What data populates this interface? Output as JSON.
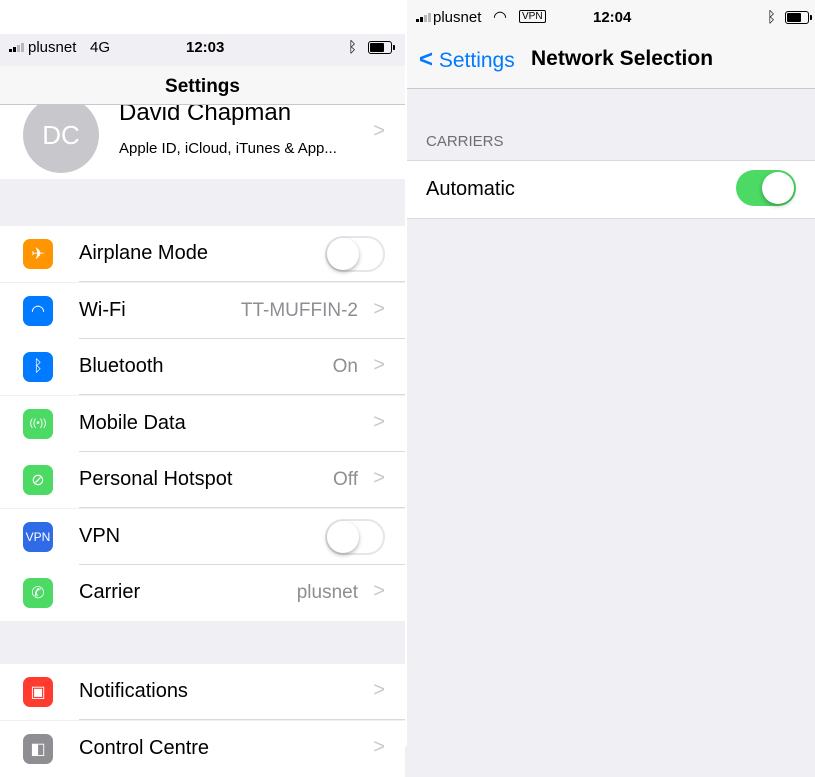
{
  "left": {
    "status": {
      "carrier": "plusnet",
      "network": "4G",
      "time": "12:03"
    },
    "nav_title": "Settings",
    "profile": {
      "initials": "DC",
      "name": "David Chapman",
      "subtitle": "Apple ID, iCloud, iTunes & App..."
    },
    "rows": [
      {
        "label": "Airplane Mode",
        "icon": "airplane-icon",
        "glyph": "✈",
        "color": "#ff9500",
        "toggle": "off"
      },
      {
        "label": "Wi-Fi",
        "icon": "wifi-icon",
        "glyph": "◠",
        "color": "#007aff",
        "value": "TT-MUFFIN-2"
      },
      {
        "label": "Bluetooth",
        "icon": "bluetooth-icon",
        "glyph": "ᛒ",
        "color": "#007aff",
        "value": "On"
      },
      {
        "label": "Mobile Data",
        "icon": "antenna-icon",
        "glyph": "((•))",
        "color": "#4cd964",
        "value": ""
      },
      {
        "label": "Personal Hotspot",
        "icon": "hotspot-icon",
        "glyph": "⊘",
        "color": "#4cd964",
        "value": "Off"
      },
      {
        "label": "VPN",
        "icon": "vpn-icon",
        "glyph": "VPN",
        "color": "#2f6be6",
        "toggle": "off"
      },
      {
        "label": "Carrier",
        "icon": "phone-icon",
        "glyph": "✆",
        "color": "#4cd964",
        "value": "plusnet"
      }
    ],
    "rows2": [
      {
        "label": "Notifications",
        "icon": "notifications-icon",
        "glyph": "▣",
        "color": "#ff3b30",
        "value": ""
      },
      {
        "label": "Control Centre",
        "icon": "control-centre-icon",
        "glyph": "◧",
        "color": "#8e8e93",
        "value": ""
      }
    ]
  },
  "right": {
    "status": {
      "carrier": "plusnet",
      "vpn": "VPN",
      "time": "12:04"
    },
    "back_label": "Settings",
    "nav_title": "Network Selection",
    "section_header": "CARRIERS",
    "automatic": {
      "label": "Automatic",
      "toggle": "on"
    }
  },
  "colors": {
    "accent": "#007aff",
    "toggle_on": "#4cd964",
    "group_bg": "#efeff4"
  }
}
